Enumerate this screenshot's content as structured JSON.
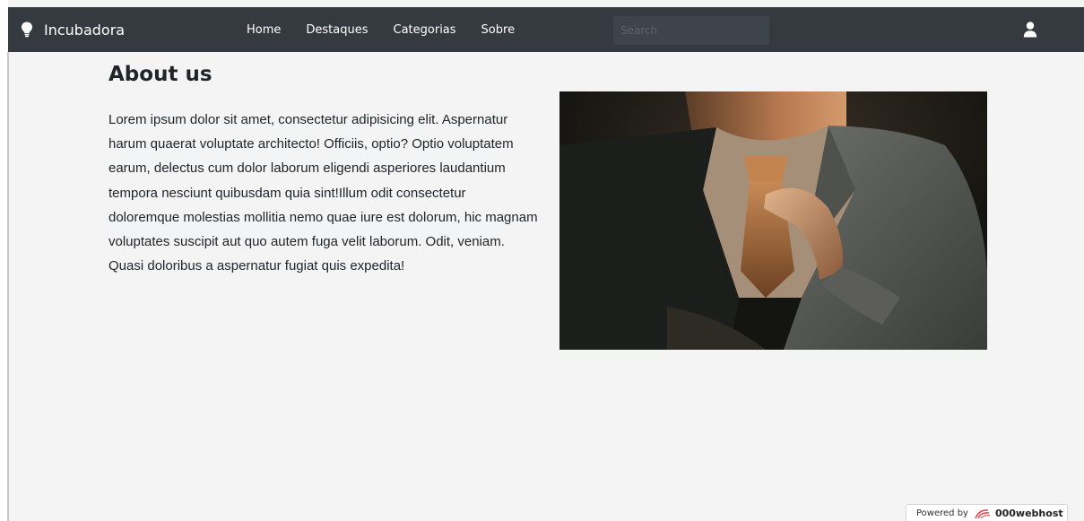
{
  "navbar": {
    "brand": "Incubadora",
    "brand_icon": "lightbulb-icon",
    "links": [
      "Home",
      "Destaques",
      "Categorias",
      "Sobre"
    ],
    "search_placeholder": "Search",
    "user_icon": "user-icon",
    "background": "#343a40"
  },
  "main": {
    "title": "About us",
    "paragraph": "Lorem ipsum dolor sit amet, consectetur adipisicing elit. Aspernatur harum quaerat voluptate architecto! Officiis, optio? Optio voluptatem earum, delectus cum dolor laborum eligendi asperiores laudantium tempora nesciunt quibusdam quia sint!Illum odit consectetur doloremque molestias mollitia nemo quae iure est dolorum, hic magnam voluptates suscipit aut quo autem fuga velit laborum. Odit, veniam. Quasi doloribus a aspernatur fugiat quis expedita!"
  },
  "footer_badge": {
    "prefix": "Powered by",
    "host": "000webhost",
    "logo_icon": "000webhost-logo-icon"
  }
}
